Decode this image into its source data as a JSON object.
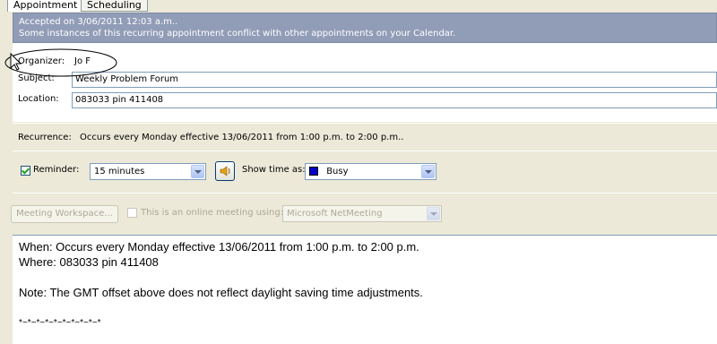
{
  "tabs": [
    {
      "label": "Appointment",
      "active": true
    },
    {
      "label": "Scheduling",
      "active": false
    }
  ],
  "infobar": {
    "line1": "Accepted on 3/06/2011 12:03 a.m..",
    "line2": "Some instances of this recurring appointment conflict with other appointments on your Calendar."
  },
  "fields": {
    "organizer_label": "Organizer:",
    "organizer_value": "Jo F",
    "subject_label": "Subject:",
    "subject_value": "Weekly Problem Forum",
    "location_label": "Location:",
    "location_value": "083033 pin 411408"
  },
  "recurrence": {
    "label": "Recurrence:",
    "value": "Occurs every Monday effective 13/06/2011 from 1:00 p.m. to 2:00 p.m.."
  },
  "reminder": {
    "label": "Reminder:",
    "checked": true,
    "value": "15 minutes",
    "show_time_label": "Show time as:",
    "show_time_value": "Busy",
    "busy_color": "#0000c8"
  },
  "meeting": {
    "workspace_button": "Meeting Workspace...",
    "online_label": "This is an online meeting using:",
    "online_value": "Microsoft NetMeeting"
  },
  "notes": {
    "when": "When: Occurs every Monday effective 13/06/2011 from 1:00 p.m. to 2:00 p.m.",
    "where": "Where: 083033 pin 411408",
    "note": "Note: The GMT offset above does not reflect daylight saving time adjustments.",
    "separator": "*~*~*~*~*~*~*~*~*~*"
  },
  "annotation_color": "#000000"
}
